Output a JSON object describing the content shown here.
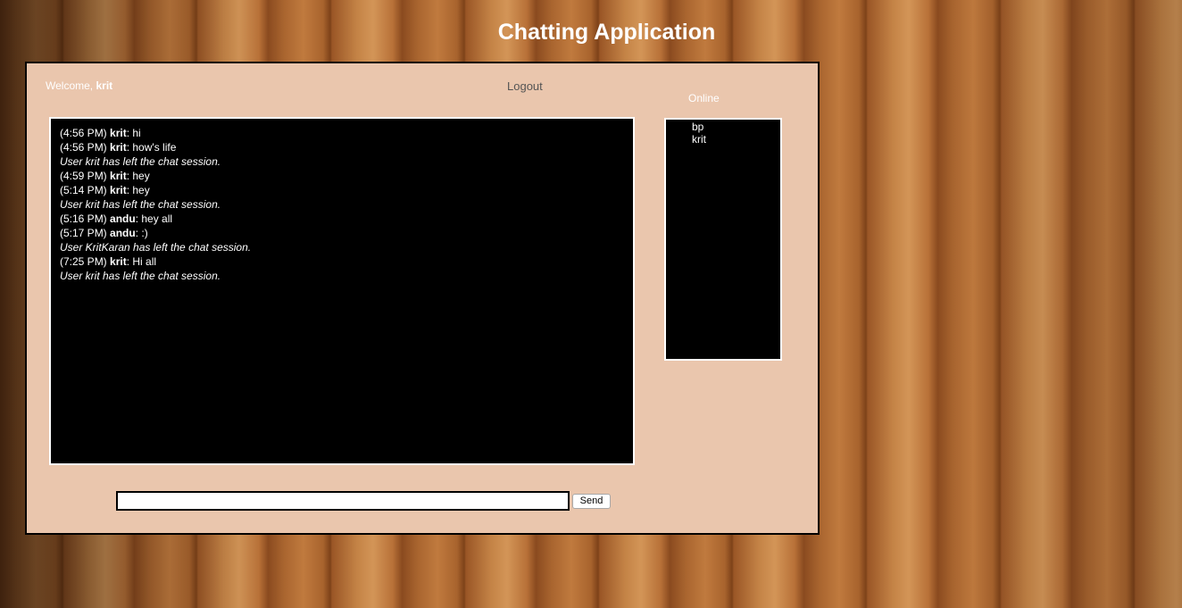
{
  "page": {
    "title": "Chatting Application"
  },
  "header": {
    "welcome_prefix": "Welcome, ",
    "username": "krit",
    "logout_label": "Logout"
  },
  "online": {
    "label": "Online",
    "users": [
      "bp",
      "krit"
    ]
  },
  "chat": {
    "messages": [
      {
        "type": "msg",
        "time": "(4:56 PM)",
        "user": "krit",
        "text": ": hi"
      },
      {
        "type": "msg",
        "time": "(4:56 PM)",
        "user": "krit",
        "text": ": how's life"
      },
      {
        "type": "system",
        "text": "User krit has left the chat session."
      },
      {
        "type": "msg",
        "time": "(4:59 PM)",
        "user": "krit",
        "text": ": hey"
      },
      {
        "type": "msg",
        "time": "(5:14 PM)",
        "user": "krit",
        "text": ": hey"
      },
      {
        "type": "system",
        "text": "User krit has left the chat session."
      },
      {
        "type": "msg",
        "time": "(5:16 PM)",
        "user": "andu",
        "text": ": hey all"
      },
      {
        "type": "msg",
        "time": "(5:17 PM)",
        "user": "andu",
        "text": ": :)"
      },
      {
        "type": "system",
        "text": "User KritKaran has left the chat session."
      },
      {
        "type": "msg",
        "time": "(7:25 PM)",
        "user": "krit",
        "text": ": Hi all"
      },
      {
        "type": "system",
        "text": "User krit has left the chat session."
      }
    ]
  },
  "composer": {
    "value": "",
    "send_label": "Send"
  }
}
